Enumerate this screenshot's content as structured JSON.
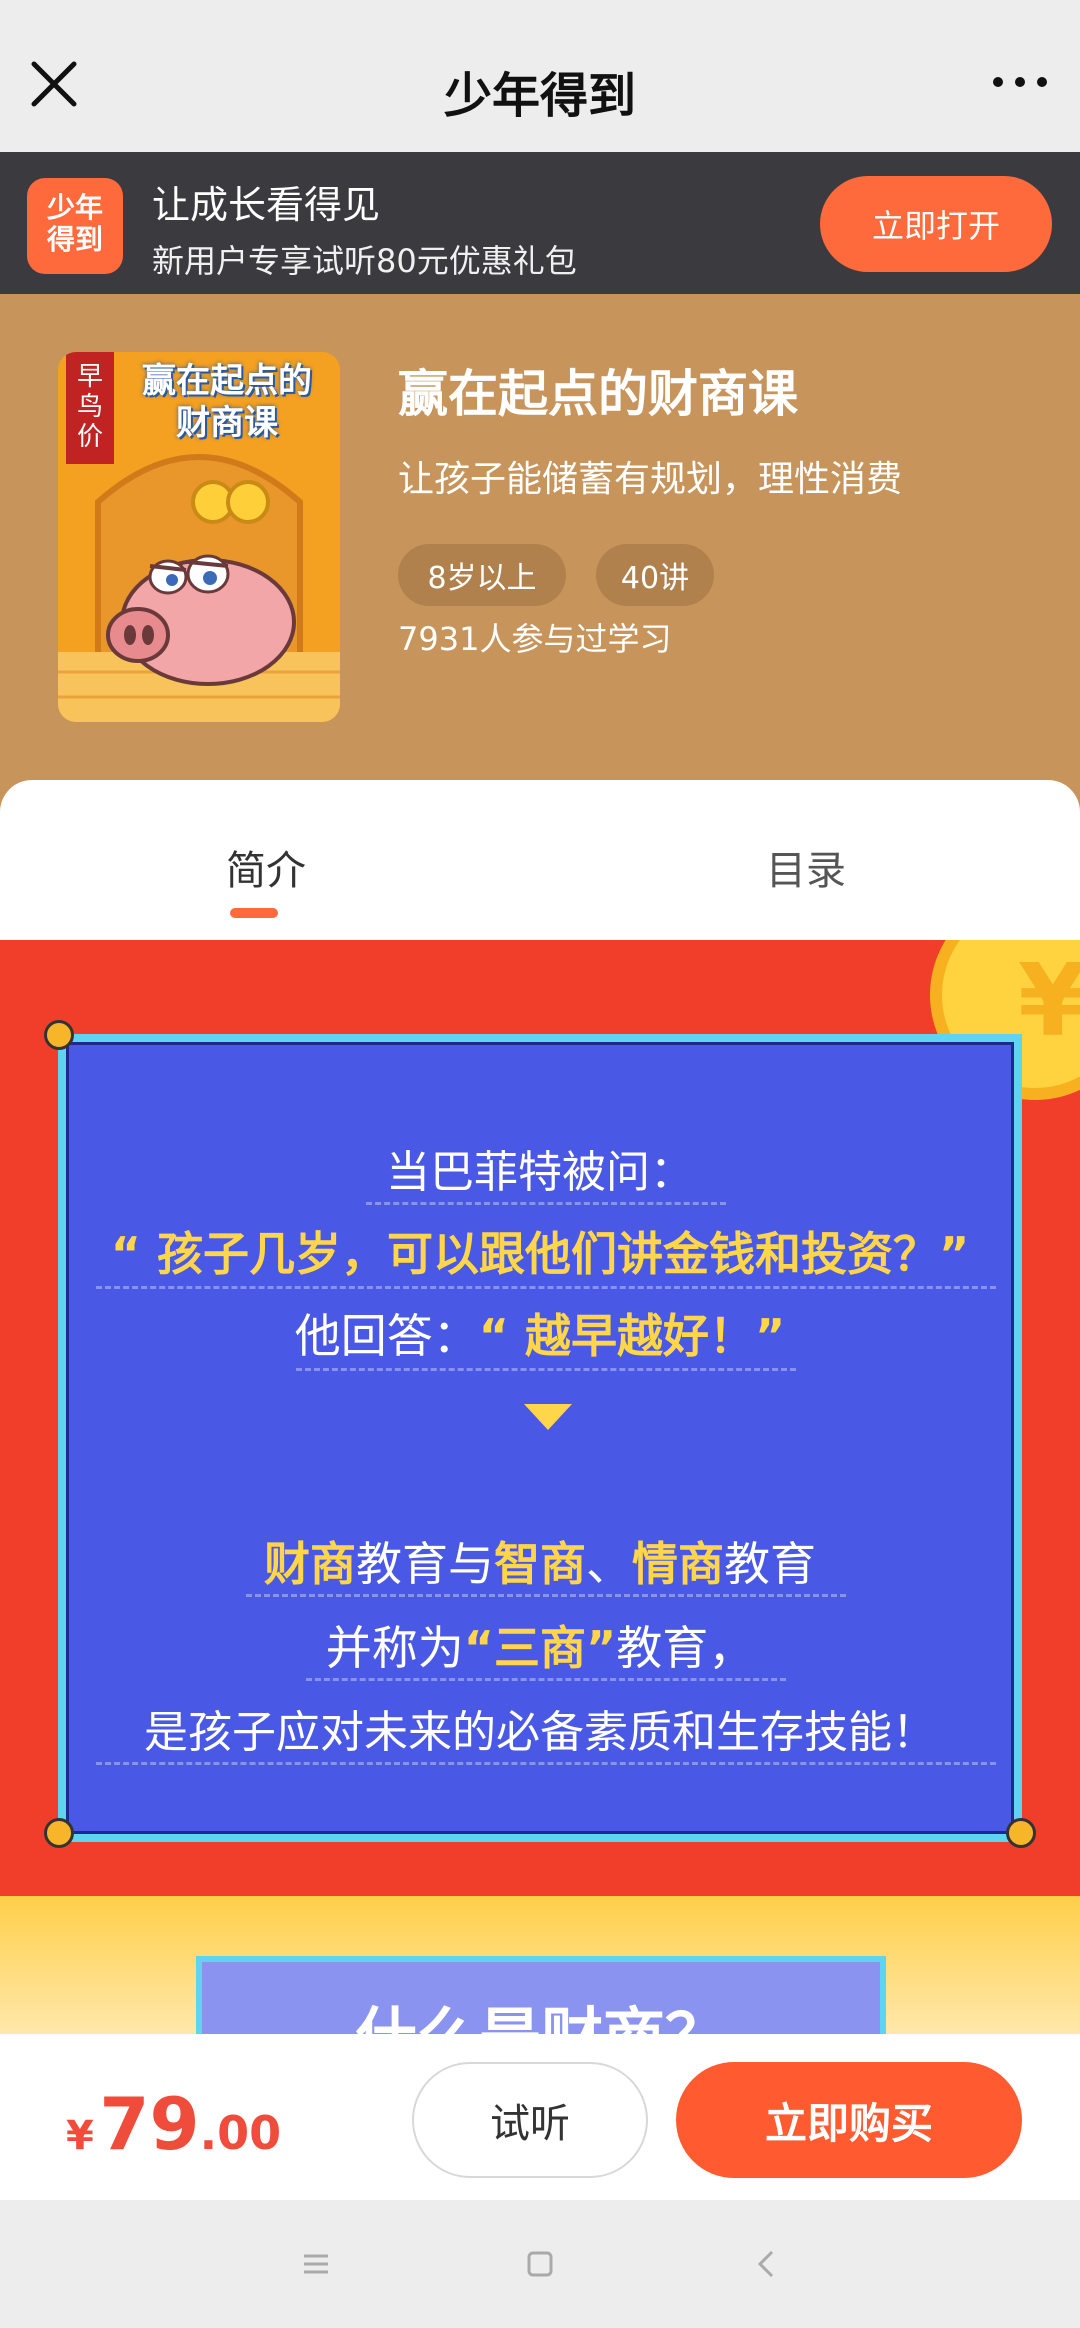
{
  "titlebar": {
    "title": "少年得到",
    "close_icon": "close-icon",
    "more_icon": "more-icon"
  },
  "banner": {
    "logo_text_1": "少年",
    "logo_text_2": "得到",
    "title": "让成长看得见",
    "subtitle": "新用户专享试听80元优惠礼包",
    "open_label": "立即打开",
    "accent": "#ff6a3d"
  },
  "course": {
    "cover": {
      "ribbon": "早鸟价",
      "title_line1": "赢在起点的",
      "title_line2": "财商课"
    },
    "name": "赢在起点的财商课",
    "description": "让孩子能储蓄有规划，理性消费",
    "tags": [
      "8岁以上",
      "40讲"
    ],
    "learners": "7931人参与过学习",
    "bg_color": "#c7955b"
  },
  "tabs": [
    {
      "label": "简介",
      "active": true
    },
    {
      "label": "目录",
      "active": false
    }
  ],
  "poster": {
    "line1": "当巴菲特被问：",
    "line2": "“ 孩子几岁，可以跟他们讲金钱和投资？”",
    "line3_prefix": "他回答：",
    "line3_highlight": "“ 越早越好！”",
    "line4_part1": "财商",
    "line4_part2": "教育与",
    "line4_part3": "智商",
    "line4_part4": "、",
    "line4_part5": "情商",
    "line4_part6": "教育",
    "line5_part1": "并称为",
    "line5_part2": "“三商”",
    "line5_part3": "教育，",
    "line6": "是孩子应对未来的必备素质和生存技能！",
    "section2_title": "什么是财商？",
    "coin_symbol": "¥"
  },
  "bottombar": {
    "currency": "¥",
    "price_int": "79",
    "price_dec": ".00",
    "trial_label": "试听",
    "buy_label": "立即购买"
  },
  "sysnav": [
    "menu-icon",
    "home-square-icon",
    "back-icon"
  ]
}
